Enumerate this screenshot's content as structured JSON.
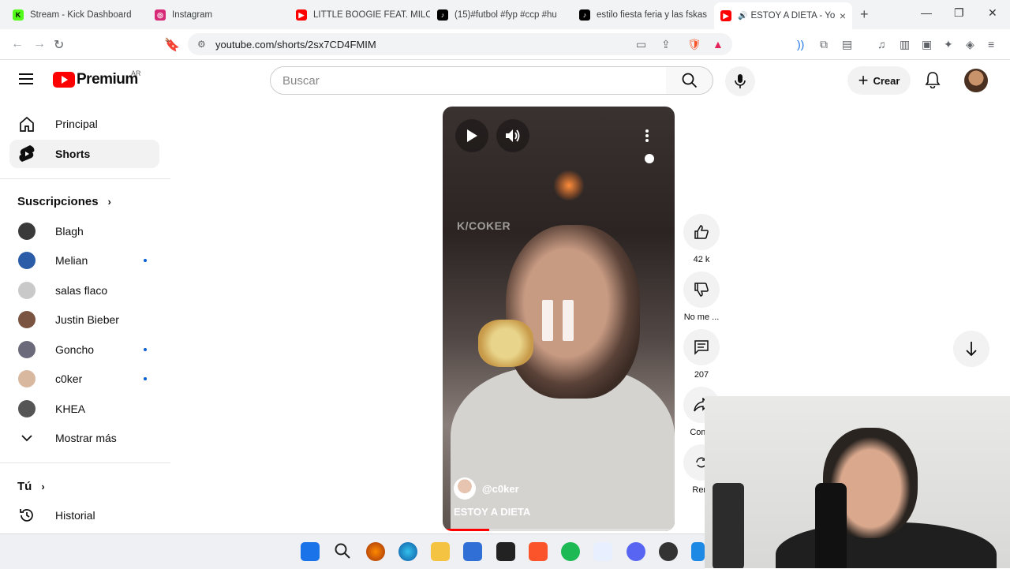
{
  "browser": {
    "tabs": [
      {
        "title": "Stream - Kick Dashboard",
        "color": "#53fc18",
        "glyph": "K"
      },
      {
        "title": "Instagram",
        "color": "#d62976",
        "glyph": "◎"
      },
      {
        "title": "LITTLE BOOGIE FEAT. MILO",
        "color": "#ff0000",
        "glyph": "▶"
      },
      {
        "title": "(15)#futbol #fyp #ccp #hu",
        "color": "#000000",
        "glyph": "♪"
      },
      {
        "title": "estilo fiesta feria y las fskas",
        "color": "#000000",
        "glyph": "♪"
      },
      {
        "title": "ESTOY A DIETA - Yo",
        "color": "#ff0000",
        "glyph": "▶"
      }
    ],
    "url": "youtube.com/shorts/2sx7CD4FMIM"
  },
  "header": {
    "logo": "Premium",
    "region": "AR",
    "search_placeholder": "Buscar",
    "create_label": "Crear"
  },
  "sidebar": {
    "nav": [
      {
        "label": "Principal",
        "icon": "home-icon"
      },
      {
        "label": "Shorts",
        "icon": "shorts-icon"
      }
    ],
    "subscriptions_title": "Suscripciones",
    "channels": [
      {
        "name": "Blagh",
        "color": "#3a3a3a",
        "new": false
      },
      {
        "name": "Melian",
        "color": "#2b5ca8",
        "new": true
      },
      {
        "name": "salas flaco",
        "color": "#c9c9c9",
        "new": false
      },
      {
        "name": "Justin Bieber",
        "color": "#7a5440",
        "new": false
      },
      {
        "name": "Goncho",
        "color": "#6a6a7a",
        "new": true
      },
      {
        "name": "c0ker",
        "color": "#d9b8a0",
        "new": true
      },
      {
        "name": "KHEA",
        "color": "#555555",
        "new": false
      }
    ],
    "show_more": "Mostrar más",
    "you_title": "Tú",
    "history": "Historial"
  },
  "short": {
    "watermark": "K/COKER",
    "channel": "@c0ker",
    "title": "ESTOY A DIETA",
    "progress": 0.2,
    "likes": "42 k",
    "dislike_label": "No me ...",
    "comments": "207",
    "share_label": "Comp",
    "remix_label": "Rem"
  }
}
